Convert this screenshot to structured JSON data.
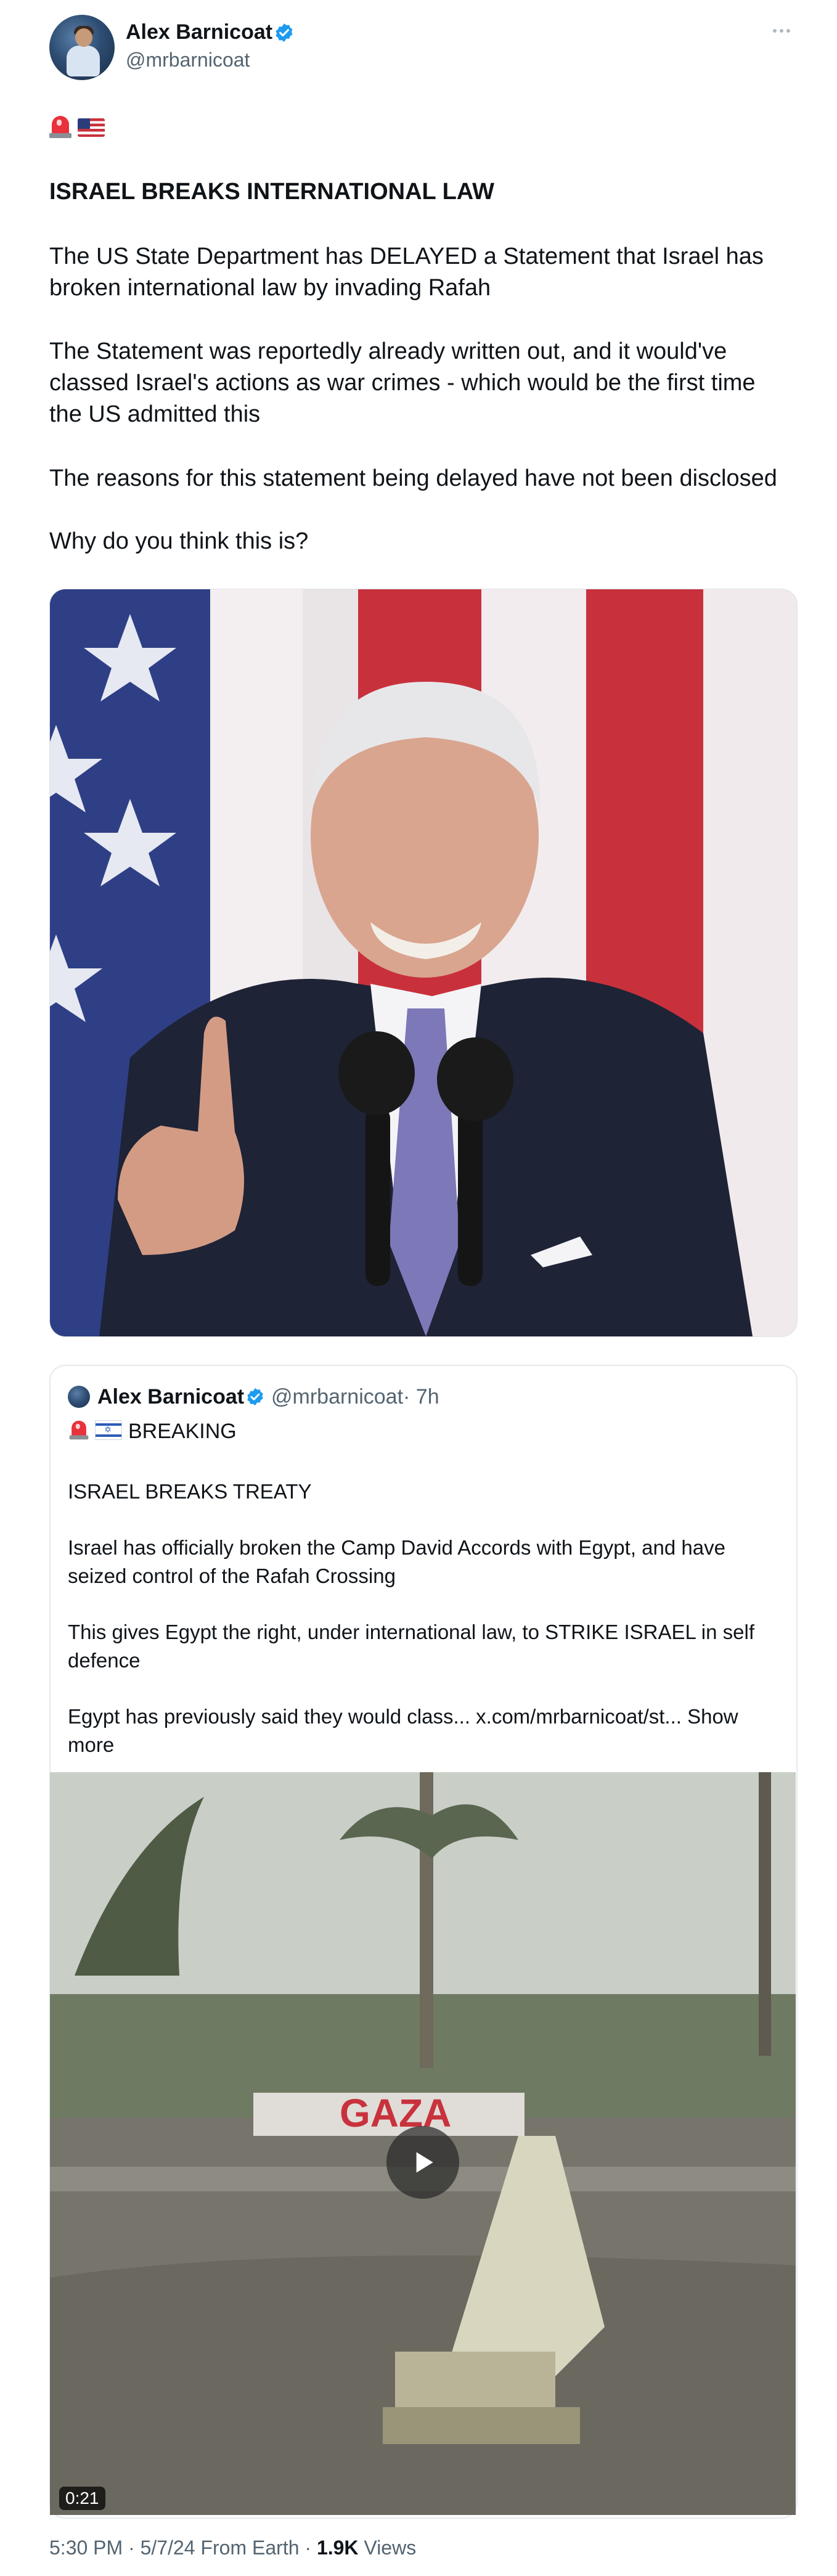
{
  "author": {
    "name": "Alex Barnicoat",
    "handle": "@mrbarnicoat",
    "verified_color": "#1d9bf0"
  },
  "tweet": {
    "emojis": [
      "police-siren",
      "us-flag"
    ],
    "headline": "ISRAEL BREAKS INTERNATIONAL LAW",
    "paragraph1": "The US State Department has DELAYED a Statement that Israel has broken international law by invading Rafah",
    "paragraph2": "The Statement was reportedly already written out, and it would've classed Israel's actions as war crimes - which would be the first time the US admitted this",
    "paragraph3": "The reasons for this statement being delayed have not been disclosed",
    "paragraph4": "Why do you think this is?"
  },
  "quoted_tweet": {
    "name": "Alex Barnicoat",
    "handle": "@mrbarnicoat",
    "time": "· 7h",
    "emojis": [
      "police-siren",
      "israel-flag"
    ],
    "breaking": "BREAKING",
    "line1": "ISRAEL BREAKS TREATY",
    "line2": "Israel has officially broken the Camp David Accords with Egypt, and have seized control of the Rafah Crossing",
    "line3": "This gives Egypt the right, under international law, to STRIKE ISRAEL in self defence",
    "line4": "Egypt has previously said they would class... x.com/mrbarnicoat/st...",
    "show_more": "Show more",
    "video_sign": "GAZA",
    "video_duration": "0:21"
  },
  "footer": {
    "timestamp": "5:30 PM · 5/7/24 From Earth · ",
    "views_count": "1.9K",
    "views_label": " Views"
  }
}
